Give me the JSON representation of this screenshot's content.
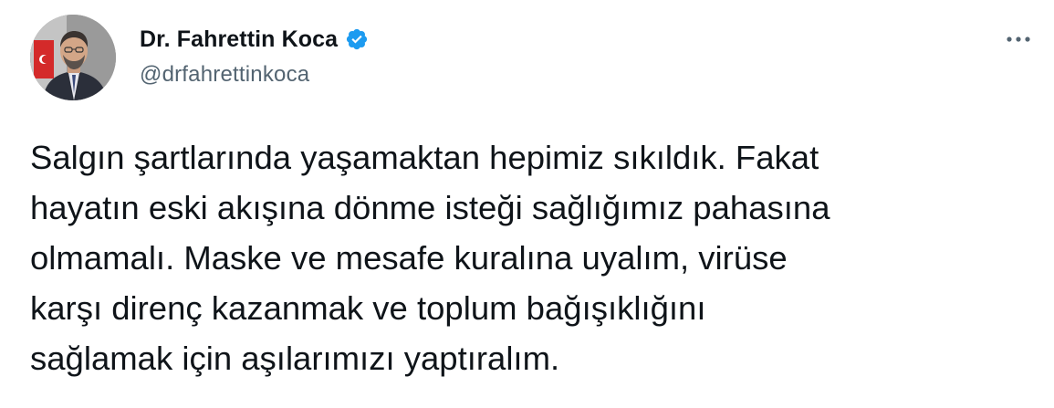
{
  "author": {
    "display_name": "Dr. Fahrettin Koca",
    "handle": "@drfahrettinkoca",
    "avatar_icon": "profile-photo",
    "verified_icon": "verified-badge-icon",
    "verified_color": "#1d9bf0"
  },
  "menu": {
    "icon": "more-horizontal-icon"
  },
  "tweet": {
    "text": "Salgın şartlarında yaşamaktan hepimiz sıkıldık. Fakat\nhayatın eski akışına dönme isteği sağlığımız pahasına\nolmamalı. Maske ve mesafe kuralına uyalım, virüse\nkarşı direnç kazanmak ve toplum bağışıklığını\nsağlamak için aşılarımızı yaptıralım."
  },
  "colors": {
    "text": "#0f1419",
    "secondary": "#536471",
    "background": "#ffffff"
  }
}
